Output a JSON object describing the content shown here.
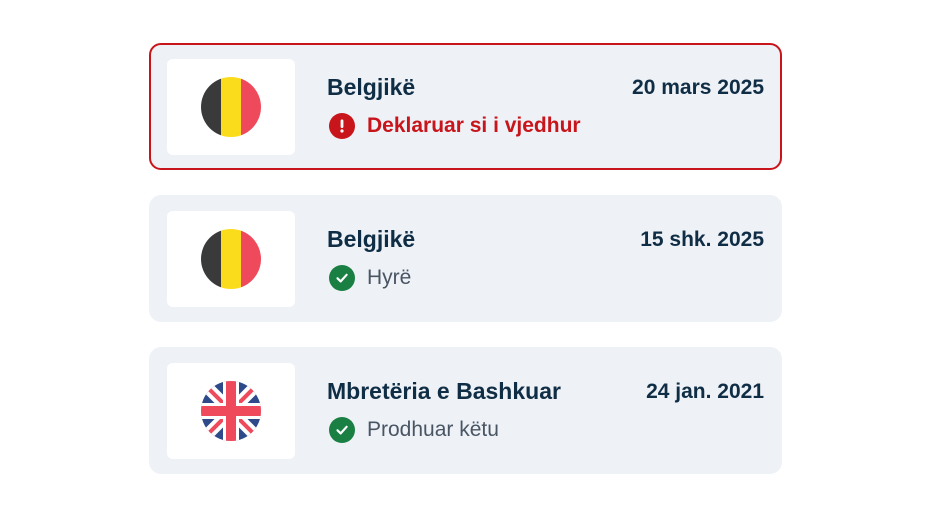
{
  "colors": {
    "alert": "#c8151b",
    "success": "#1a7f43",
    "card_background": "#eef2f7",
    "heading_text": "#0f2d44",
    "muted_text": "#4a5563"
  },
  "items": [
    {
      "flag_icon": "belgium-flag-icon",
      "country": "Belgjikë",
      "date": "20 mars 2025",
      "status": "Deklaruar si i vjedhur",
      "status_icon": "exclamation-icon",
      "status_type": "error"
    },
    {
      "flag_icon": "belgium-flag-icon",
      "country": "Belgjikë",
      "date": "15 shk. 2025",
      "status": "Hyrë",
      "status_icon": "check-icon",
      "status_type": "success"
    },
    {
      "flag_icon": "united-kingdom-flag-icon",
      "country": "Mbretëria e Bashkuar",
      "date": "24 jan. 2021",
      "status": "Prodhuar këtu",
      "status_icon": "check-icon",
      "status_type": "success"
    }
  ]
}
